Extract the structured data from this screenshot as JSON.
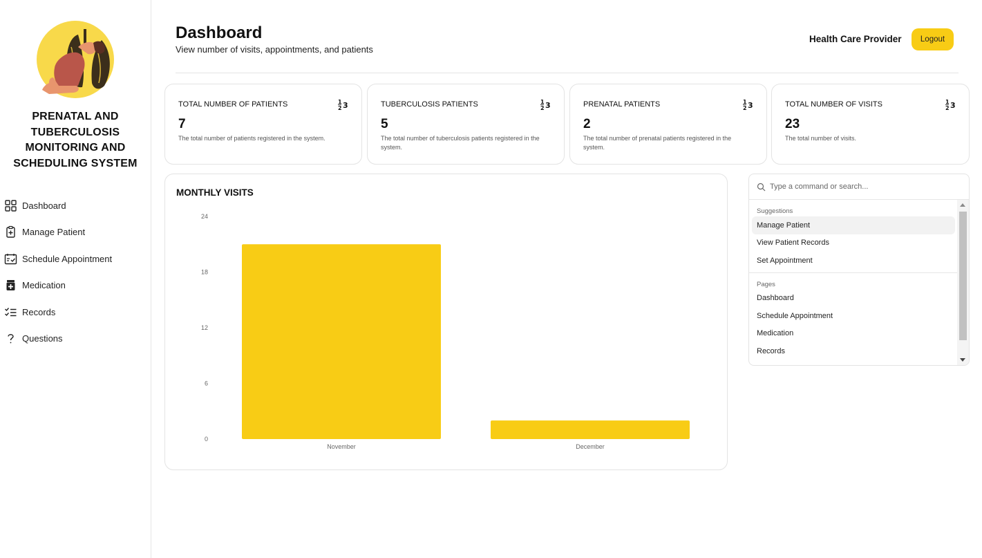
{
  "app": {
    "title": "PRENATAL AND TUBERCULOSIS MONITORING AND SCHEDULING SYSTEM"
  },
  "sidebar": {
    "items": [
      {
        "label": "Dashboard",
        "icon": "dashboard-grid-icon"
      },
      {
        "label": "Manage Patient",
        "icon": "clipboard-plus-icon"
      },
      {
        "label": "Schedule Appointment",
        "icon": "calendar-check-icon"
      },
      {
        "label": "Medication",
        "icon": "medicine-box-icon"
      },
      {
        "label": "Records",
        "icon": "checklist-icon"
      },
      {
        "label": "Questions",
        "icon": "question-mark-icon"
      }
    ]
  },
  "header": {
    "title": "Dashboard",
    "subtitle": "View number of visits, appointments, and patients",
    "role": "Health Care Provider",
    "logout_label": "Logout"
  },
  "stats": [
    {
      "label": "TOTAL NUMBER OF PATIENTS",
      "value": "7",
      "description": "The total number of patients registered in the system.",
      "icon": "numbers-icon"
    },
    {
      "label": "TUBERCULOSIS PATIENTS",
      "value": "5",
      "description": "The total number of tuberculosis patients registered in the system.",
      "icon": "numbers-icon"
    },
    {
      "label": "PRENATAL PATIENTS",
      "value": "2",
      "description": "The total number of prenatal patients registered in the system.",
      "icon": "numbers-icon"
    },
    {
      "label": "TOTAL NUMBER OF VISITS",
      "value": "23",
      "description": "The total number of visits.",
      "icon": "numbers-icon"
    }
  ],
  "chart_data": {
    "type": "bar",
    "title": "MONTHLY VISITS",
    "categories": [
      "November",
      "December"
    ],
    "values": [
      21,
      2
    ],
    "ylim": [
      0,
      24
    ],
    "yticks": [
      0,
      6,
      12,
      18,
      24
    ],
    "xlabel": "",
    "ylabel": "",
    "grid": false,
    "bar_color": "#f8cc15"
  },
  "command": {
    "placeholder": "Type a command or search...",
    "groups": [
      {
        "label": "Suggestions",
        "items": [
          "Manage Patient",
          "View Patient Records",
          "Set Appointment"
        ]
      },
      {
        "label": "Pages",
        "items": [
          "Dashboard",
          "Schedule Appointment",
          "Medication",
          "Records"
        ]
      }
    ],
    "active_item": "Manage Patient"
  },
  "colors": {
    "accent": "#f8cc15",
    "border": "#e3e3e3"
  }
}
